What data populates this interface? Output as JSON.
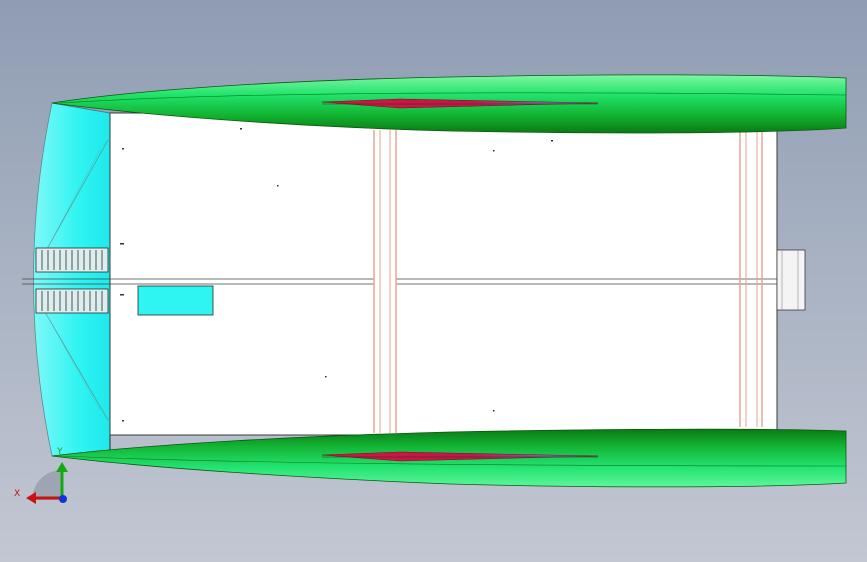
{
  "viewport": {
    "background_top": "#8f9cb2",
    "background_bottom": "#c2c7d2"
  },
  "model": {
    "name": "catamaran-top-view",
    "hull_color_light": "#3ff39a",
    "hull_color_dark": "#0b8a18",
    "hull_tip_color": "#16cf3c",
    "waterline_color": "#d01640",
    "bridge_deck_color": "#ffffff",
    "bow_panel_color": "#2ef4f2",
    "hatch_color": "#2ef4f2",
    "beam_color": "#e8a090"
  },
  "triad": {
    "x_label": "X",
    "y_label": "Y",
    "x_color": "#cc1111",
    "y_color": "#11aa11",
    "z_color": "#1133dd"
  }
}
